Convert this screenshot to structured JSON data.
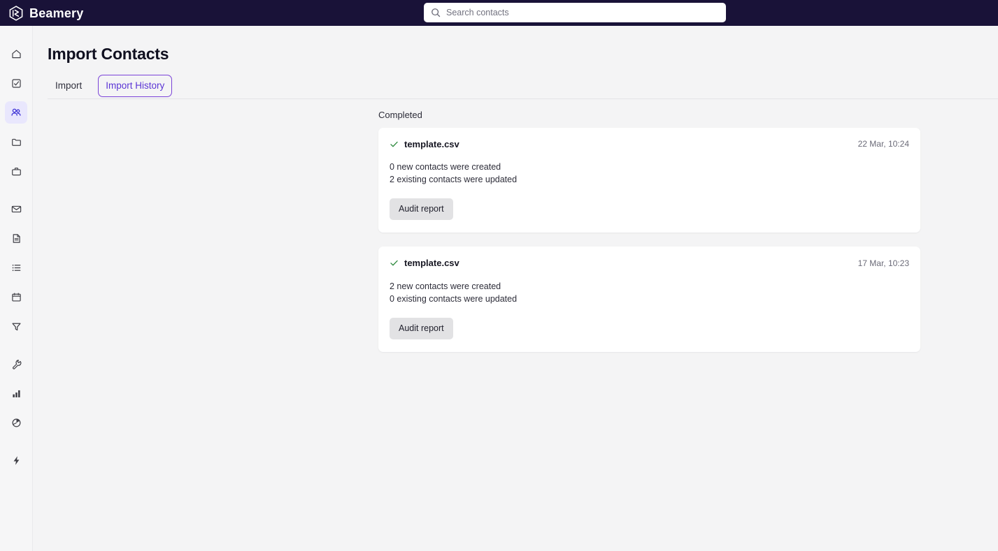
{
  "topbar": {
    "brand_name": "Beamery",
    "brand_icon": "beamery-hexagon-logo",
    "search": {
      "icon": "search-icon",
      "placeholder": "Search contacts",
      "value": ""
    }
  },
  "sidebar": {
    "items": [
      {
        "icon": "home-icon",
        "name": "home",
        "active": false
      },
      {
        "icon": "task-check-icon",
        "name": "tasks",
        "active": false
      },
      {
        "icon": "people-icon",
        "name": "contacts",
        "active": true
      },
      {
        "icon": "folder-icon",
        "name": "pools",
        "active": false
      },
      {
        "icon": "briefcase-icon",
        "name": "vacancies",
        "active": false
      },
      {
        "icon": "envelope-icon",
        "name": "messages",
        "active": false
      },
      {
        "icon": "document-icon",
        "name": "documents",
        "active": false
      },
      {
        "icon": "list-icon",
        "name": "lists",
        "active": false
      },
      {
        "icon": "calendar-icon",
        "name": "calendar",
        "active": false
      },
      {
        "icon": "funnel-icon",
        "name": "filters",
        "active": false
      },
      {
        "icon": "wrench-icon",
        "name": "tools",
        "active": false
      },
      {
        "icon": "bar-chart-icon",
        "name": "analytics",
        "active": false
      },
      {
        "icon": "pie-chart-icon",
        "name": "reports",
        "active": false
      },
      {
        "icon": "lightning-icon",
        "name": "automations",
        "active": false
      }
    ]
  },
  "page": {
    "title": "Import Contacts",
    "tabs": [
      {
        "label": "Import",
        "active": false
      },
      {
        "label": "Import History",
        "active": true
      }
    ]
  },
  "colors": {
    "brand_navy": "#191238",
    "accent_purple": "#5b35d5",
    "accent_purple_border": "#7b43d8",
    "active_rail_bg": "#e9e7fd",
    "success_green": "#2f8a3f",
    "page_bg": "#f4f4f5",
    "card_bg": "#ffffff",
    "button_bg": "#e2e2e4"
  },
  "import_history": {
    "section_label": "Completed",
    "entries": [
      {
        "status_icon": "check-icon",
        "file_name": "template.csv",
        "timestamp": "22 Mar, 10:24",
        "created_line": "0 new contacts were created",
        "updated_line": "2 existing contacts were updated",
        "action_label": "Audit report"
      },
      {
        "status_icon": "check-icon",
        "file_name": "template.csv",
        "timestamp": "17 Mar, 10:23",
        "created_line": "2 new contacts were created",
        "updated_line": "0 existing contacts were updated",
        "action_label": "Audit report"
      }
    ]
  }
}
